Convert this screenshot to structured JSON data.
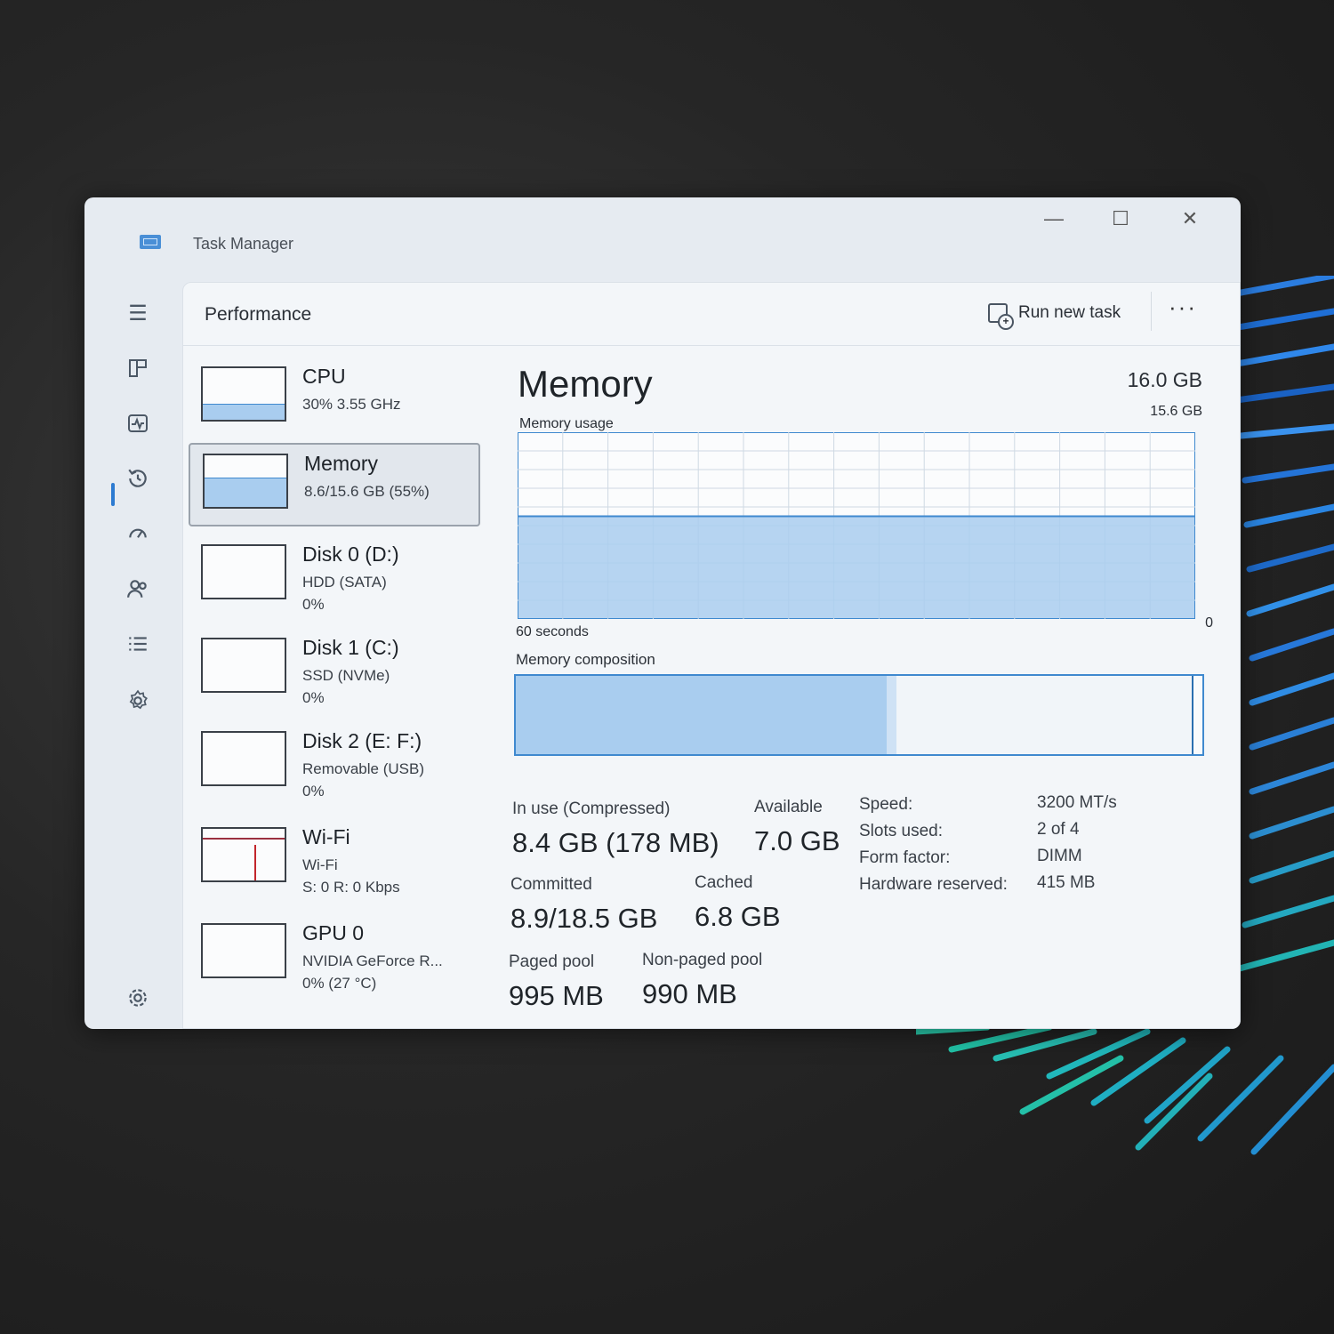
{
  "window": {
    "title": "Task Manager"
  },
  "header": {
    "page_title": "Performance",
    "run_new_task": "Run new task",
    "more": "···"
  },
  "nav": [
    "menu-icon",
    "processes-icon",
    "performance-icon",
    "app-history-icon",
    "startup-apps-icon",
    "users-icon",
    "details-icon",
    "services-icon",
    "settings-icon"
  ],
  "devices": [
    {
      "name": "CPU",
      "line1": "30% 3.55 GHz",
      "line2": "",
      "fill": 0.3
    },
    {
      "name": "Memory",
      "line1": "8.6/15.6 GB (55%)",
      "line2": "",
      "fill": 0.55
    },
    {
      "name": "Disk 0 (D:)",
      "line1": "HDD (SATA)",
      "line2": "0%",
      "fill": 0
    },
    {
      "name": "Disk 1 (C:)",
      "line1": "SSD (NVMe)",
      "line2": "0%",
      "fill": 0
    },
    {
      "name": "Disk 2 (E: F:)",
      "line1": "Removable (USB)",
      "line2": "0%",
      "fill": 0
    },
    {
      "name": "Wi-Fi",
      "line1": "Wi-Fi",
      "line2": "S: 0 R: 0 Kbps",
      "fill": 0
    },
    {
      "name": "GPU 0",
      "line1": "NVIDIA GeForce R...",
      "line2": "0% (27 °C)",
      "fill": 0
    }
  ],
  "memory": {
    "title": "Memory",
    "total": "16.0 GB",
    "usage_label": "Memory usage",
    "usage_max": "15.6 GB",
    "x_left": "60 seconds",
    "x_right": "0",
    "usage_fraction": 0.55,
    "composition_label": "Memory composition",
    "composition": {
      "in_use_fraction": 0.54,
      "modified_fraction": 0.015,
      "standby_fraction": 0.43
    },
    "in_use_label": "In use (Compressed)",
    "in_use_value": "8.4 GB (178 MB)",
    "available_label": "Available",
    "available_value": "7.0 GB",
    "committed_label": "Committed",
    "committed_value": "8.9/18.5 GB",
    "cached_label": "Cached",
    "cached_value": "6.8 GB",
    "paged_label": "Paged pool",
    "paged_value": "995 MB",
    "nonpaged_label": "Non-paged pool",
    "nonpaged_value": "990 MB",
    "specs": [
      {
        "label": "Speed:",
        "value": "3200 MT/s"
      },
      {
        "label": "Slots used:",
        "value": "2 of 4"
      },
      {
        "label": "Form factor:",
        "value": "DIMM"
      },
      {
        "label": "Hardware reserved:",
        "value": "415 MB"
      }
    ]
  },
  "colors": {
    "accent": "#3f89cf",
    "fill": "#a9cdef",
    "wifi_spike": "#c2262b"
  }
}
